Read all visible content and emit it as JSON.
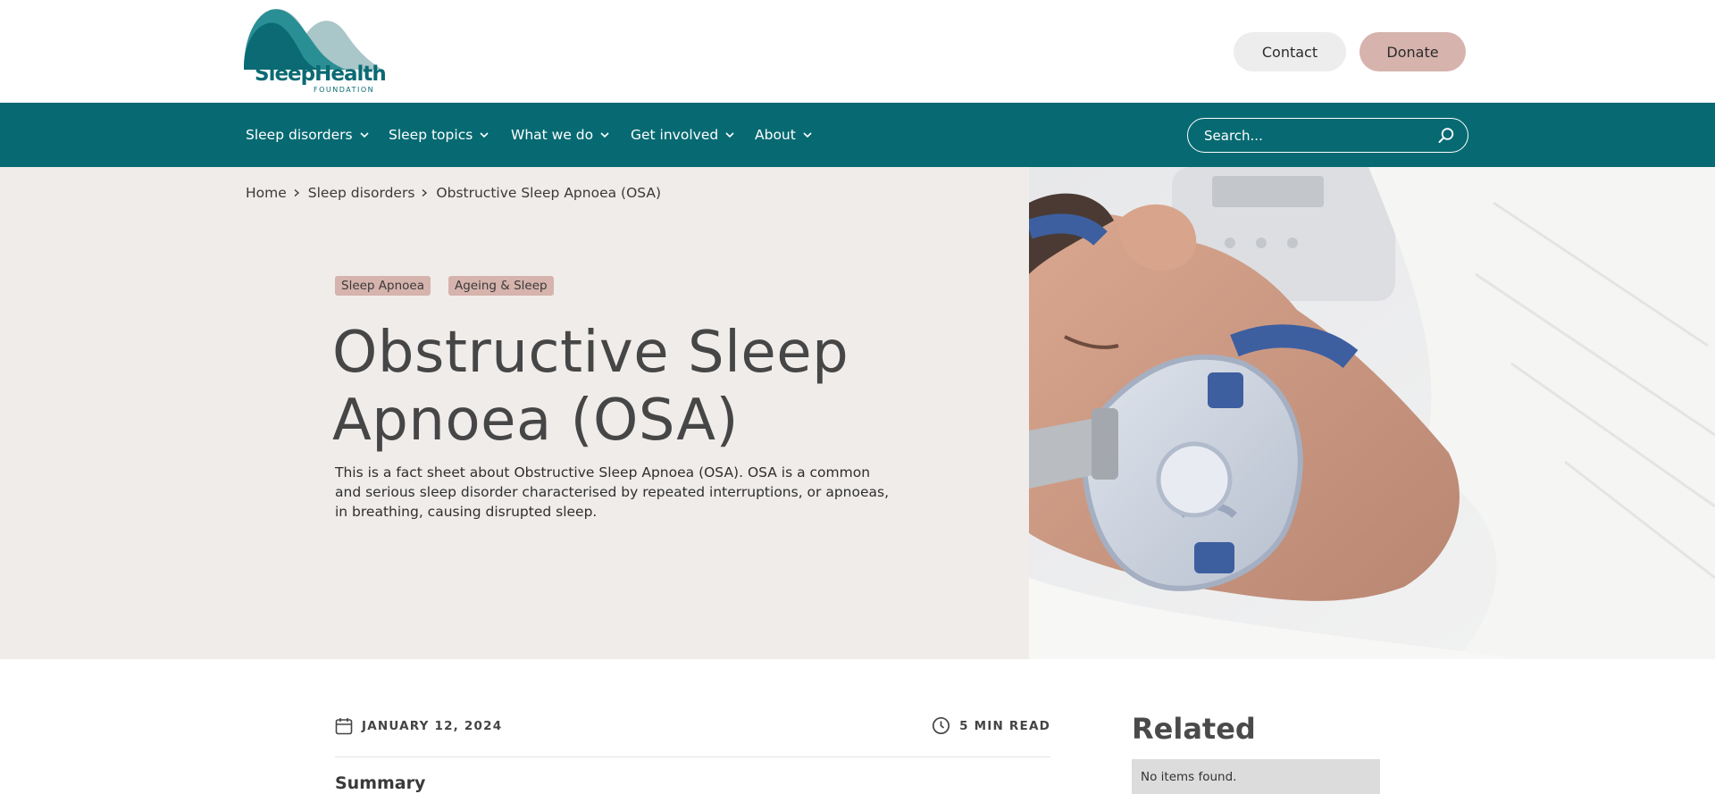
{
  "header": {
    "logo_text": "SleepHealth",
    "logo_subtext": "FOUNDATION",
    "contact_label": "Contact",
    "donate_label": "Donate"
  },
  "nav": {
    "items": [
      {
        "label": "Sleep disorders"
      },
      {
        "label": "Sleep topics"
      },
      {
        "label": "What we do"
      },
      {
        "label": "Get involved"
      },
      {
        "label": "About"
      }
    ],
    "search_placeholder": "Search..."
  },
  "breadcrumb": [
    "Home",
    "Sleep disorders",
    "Obstructive Sleep Apnoea (OSA)"
  ],
  "hero": {
    "tags": [
      "Sleep Apnoea",
      "Ageing & Sleep"
    ],
    "title": "Obstructive Sleep Apnoea (OSA)",
    "description": "This is a fact sheet about Obstructive Sleep Apnoea (OSA). OSA is a common and serious sleep disorder characterised by repeated interruptions, or apnoeas, in breathing, causing disrupted sleep."
  },
  "article": {
    "date": "JANUARY 12, 2024",
    "read_time": "5 MIN READ",
    "summary_heading": "Summary"
  },
  "related": {
    "title": "Related",
    "empty_message": "No items found."
  },
  "colors": {
    "brand_teal": "#076a72",
    "accent_pink": "#d6b3ad",
    "hero_bg": "#efecea"
  },
  "icons": [
    "chevron-down-icon",
    "search-icon",
    "chevron-right-icon",
    "calendar-icon",
    "clock-icon"
  ]
}
